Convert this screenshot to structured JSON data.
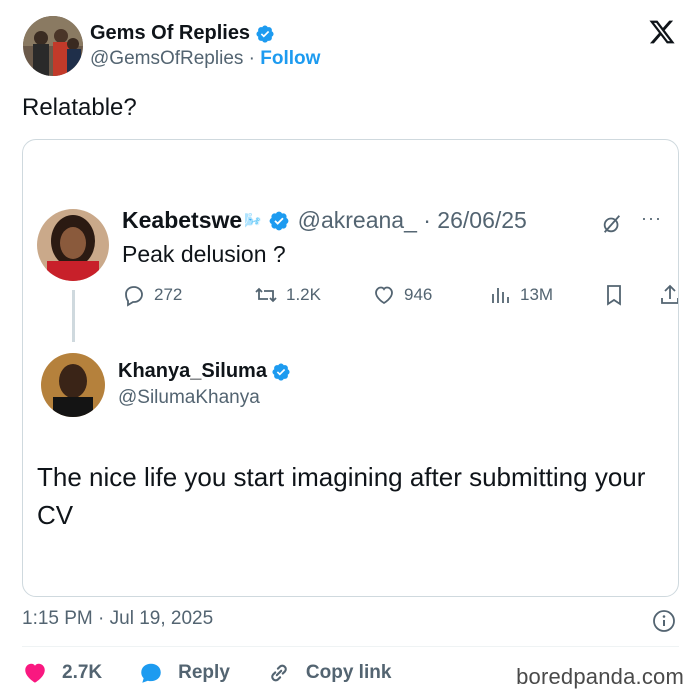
{
  "post": {
    "author_name": "Gems Of Replies",
    "author_handle": "@GemsOfReplies",
    "separator": "·",
    "follow_label": "Follow",
    "text": "Relatable?",
    "timestamp": "1:15 PM · Jul 19, 2025"
  },
  "quoted": {
    "name": "Keabetswe",
    "name_emoji": "🌬️",
    "handle_date": "@akreana_ · 26/06/25",
    "text": "Peak delusion ?",
    "replies": "272",
    "reposts": "1.2K",
    "likes": "946",
    "views": "13M"
  },
  "reply_tweet": {
    "name": "Khanya_Siluma",
    "handle": "@SilumaKhanya",
    "text": "The nice life you start imagining after submitting your CV"
  },
  "footer": {
    "likes_count": "2.7K",
    "reply_label": "Reply",
    "copy_link_label": "Copy link"
  },
  "watermark": "boredpanda.com",
  "icons": {
    "verified": "verified-badge-icon",
    "x_logo": "x-logo-icon",
    "grok": "grok-icon",
    "more": "more-icon",
    "reply": "reply-icon",
    "repost": "repost-icon",
    "like": "like-icon",
    "views": "views-icon",
    "bookmark": "bookmark-icon",
    "share": "share-icon",
    "info": "info-icon",
    "heart": "heart-icon",
    "chat": "chat-bubble-icon",
    "link": "link-icon"
  },
  "colors": {
    "accent": "#1d9bf0",
    "heart": "#f91880",
    "secondary_text": "#536471",
    "border": "#cfd9de"
  }
}
